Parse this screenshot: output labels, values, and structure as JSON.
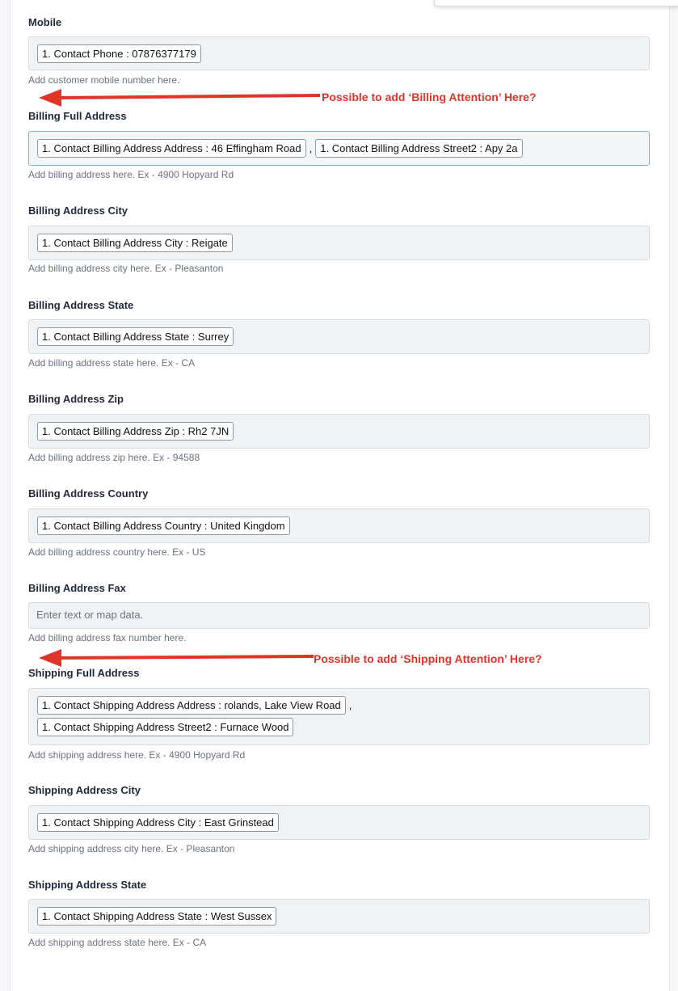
{
  "fields": {
    "mobile": {
      "label": "Mobile",
      "chips": [
        "1. Contact Phone : 07876377179"
      ],
      "help": "Add customer mobile number here."
    },
    "billing_full_address": {
      "label": "Billing Full Address",
      "chips": [
        "1. Contact Billing Address Address : 46 Effingham Road",
        "1. Contact Billing Address Street2 : Apy 2a"
      ],
      "separator": ",",
      "help": "Add billing address here. Ex - 4900 Hopyard Rd"
    },
    "billing_city": {
      "label": "Billing Address City",
      "chips": [
        "1. Contact Billing Address City : Reigate"
      ],
      "help": "Add billing address city here. Ex - Pleasanton"
    },
    "billing_state": {
      "label": "Billing Address State",
      "chips": [
        "1. Contact Billing Address State : Surrey"
      ],
      "help": "Add billing address state here. Ex - CA"
    },
    "billing_zip": {
      "label": "Billing Address Zip",
      "chips": [
        "1. Contact Billing Address Zip : Rh2 7JN"
      ],
      "help": "Add billing address zip here. Ex - 94588"
    },
    "billing_country": {
      "label": "Billing Address Country",
      "chips": [
        "1. Contact Billing Address Country : United Kingdom"
      ],
      "help": "Add billing address country here. Ex - US"
    },
    "billing_fax": {
      "label": "Billing Address Fax",
      "placeholder": "Enter text or map data.",
      "help": "Add billing address fax number here."
    },
    "shipping_full_address": {
      "label": "Shipping Full Address",
      "chips": [
        "1. Contact Shipping Address Address : rolands, Lake View Road",
        "1. Contact Shipping Address Street2 : Furnace Wood"
      ],
      "separator": ",",
      "help": "Add shipping address here. Ex - 4900 Hopyard Rd"
    },
    "shipping_city": {
      "label": "Shipping Address City",
      "chips": [
        "1. Contact Shipping Address City : East Grinstead"
      ],
      "help": "Add shipping address city here. Ex - Pleasanton"
    },
    "shipping_state": {
      "label": "Shipping Address State",
      "chips": [
        "1. Contact Shipping Address State : West Sussex"
      ],
      "help": "Add shipping address state here. Ex - CA"
    }
  },
  "annotations": {
    "billing_attention": "Possible to add ‘Billing Attention’ Here?",
    "shipping_attention": "Possible to add ‘Shipping Attention’ Here?"
  },
  "colors": {
    "annotation": "#e0332a",
    "chip_border": "#8e969e",
    "field_background": "#f0f3f6",
    "focus_border": "#7bb1d8"
  }
}
